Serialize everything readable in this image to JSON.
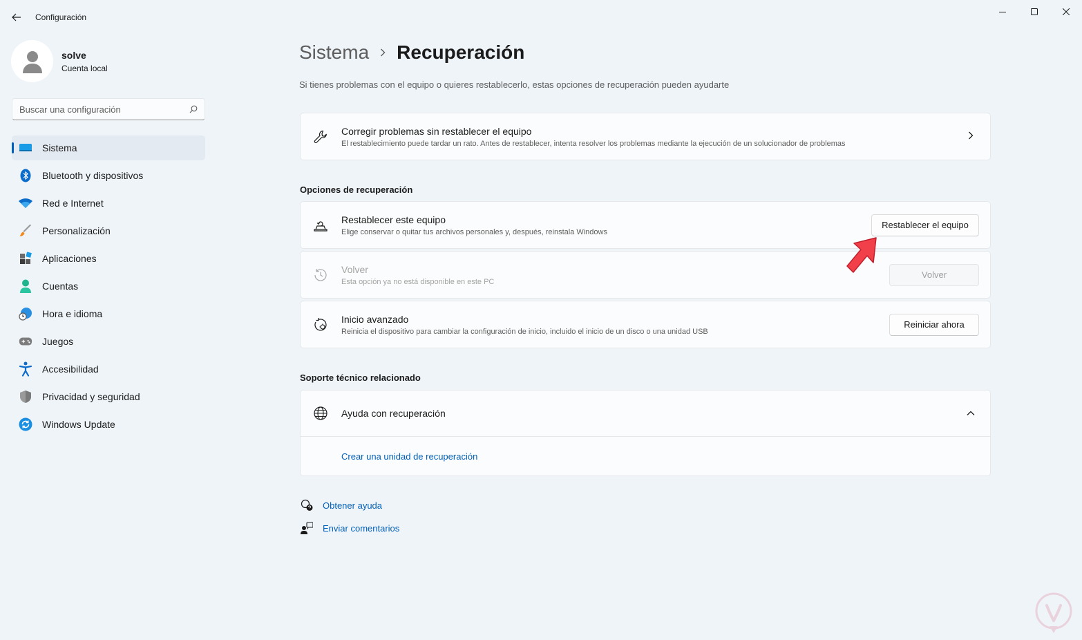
{
  "window": {
    "title": "Configuración"
  },
  "profile": {
    "name": "solve",
    "account": "Cuenta local"
  },
  "search": {
    "placeholder": "Buscar una configuración"
  },
  "sidebar": {
    "items": [
      {
        "label": "Sistema",
        "icon": "monitor-icon",
        "active": true
      },
      {
        "label": "Bluetooth y dispositivos",
        "icon": "bluetooth-icon"
      },
      {
        "label": "Red e Internet",
        "icon": "wifi-icon"
      },
      {
        "label": "Personalización",
        "icon": "brush-icon"
      },
      {
        "label": "Aplicaciones",
        "icon": "apps-icon"
      },
      {
        "label": "Cuentas",
        "icon": "person-icon"
      },
      {
        "label": "Hora e idioma",
        "icon": "globe-clock-icon"
      },
      {
        "label": "Juegos",
        "icon": "gamepad-icon"
      },
      {
        "label": "Accesibilidad",
        "icon": "accessibility-icon"
      },
      {
        "label": "Privacidad y seguridad",
        "icon": "shield-icon"
      },
      {
        "label": "Windows Update",
        "icon": "update-icon"
      }
    ]
  },
  "breadcrumb": {
    "parent": "Sistema",
    "current": "Recuperación"
  },
  "subtitle": "Si tienes problemas con el equipo o quieres restablecerlo, estas opciones de recuperación pueden ayudarte",
  "fix_card": {
    "title": "Corregir problemas sin restablecer el equipo",
    "desc": "El restablecimiento puede tardar un rato. Antes de restablecer, intenta resolver los problemas mediante la ejecución de un solucionador de problemas"
  },
  "recovery_options": {
    "heading": "Opciones de recuperación",
    "reset": {
      "title": "Restablecer este equipo",
      "desc": "Elige conservar o quitar tus archivos personales y, después, reinstala Windows",
      "button": "Restablecer el equipo"
    },
    "goback": {
      "title": "Volver",
      "desc": "Esta opción ya no está disponible en este PC",
      "button": "Volver"
    },
    "advanced": {
      "title": "Inicio avanzado",
      "desc": "Reinicia el dispositivo para cambiar la configuración de inicio, incluido el inicio de un disco o una unidad USB",
      "button": "Reiniciar ahora"
    }
  },
  "support": {
    "heading": "Soporte técnico relacionado",
    "help_title": "Ayuda con recuperación",
    "link": "Crear una unidad de recuperación"
  },
  "footer": {
    "help": "Obtener ayuda",
    "feedback": "Enviar comentarios"
  },
  "colors": {
    "accent": "#005fb8",
    "background": "#eff4f9",
    "card": "#fbfcfd",
    "arrow": "#f2404b"
  }
}
